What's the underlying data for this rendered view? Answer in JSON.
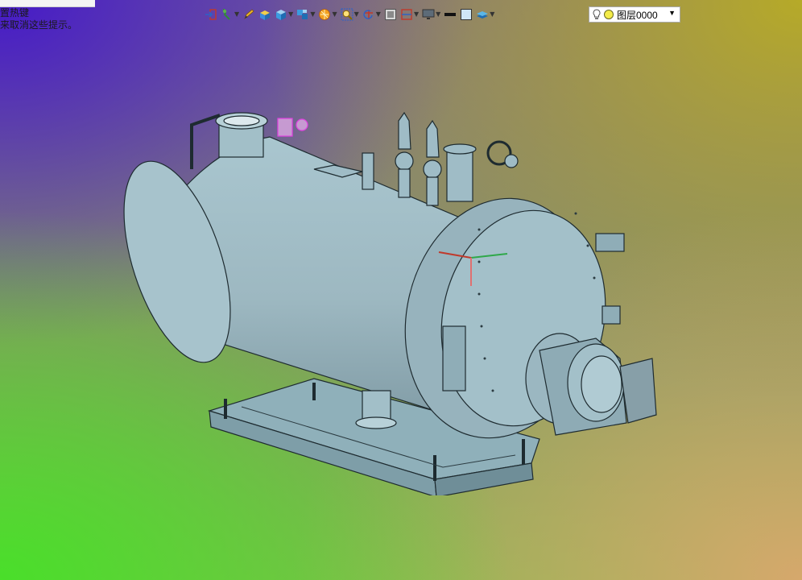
{
  "hint": {
    "line1": "置热键",
    "line2": "来取消这些提示。"
  },
  "toolbar": {
    "tools": [
      {
        "name": "import-icon",
        "has_menu": false
      },
      {
        "name": "measure-tool-icon",
        "has_menu": true
      },
      {
        "name": "pencil-icon",
        "has_menu": false
      },
      {
        "name": "material-box-icon",
        "has_menu": false
      },
      {
        "name": "cube-icon",
        "has_menu": true
      },
      {
        "name": "assembly-icon",
        "has_menu": true
      },
      {
        "name": "render-ball-icon",
        "has_menu": true
      },
      {
        "name": "zoom-icon",
        "has_menu": true
      },
      {
        "name": "rotate-icon",
        "has_menu": true
      },
      {
        "name": "view-frame-icon",
        "has_menu": false
      },
      {
        "name": "section-icon",
        "has_menu": true
      },
      {
        "name": "display-mode-icon",
        "has_menu": true
      },
      {
        "name": "line-color-icon",
        "has_menu": false
      },
      {
        "name": "fill-color-icon",
        "has_menu": false
      },
      {
        "name": "layers-icon",
        "has_menu": true
      }
    ],
    "layer_select": {
      "value": "图层0000",
      "bulb_icon": "lightbulb-icon",
      "color_icon": "yellow-dot-icon"
    }
  },
  "colors": {
    "model_fill": "#9fbcc6",
    "model_edge": "#1e2b30",
    "selection_magenta": "#e040e0"
  }
}
